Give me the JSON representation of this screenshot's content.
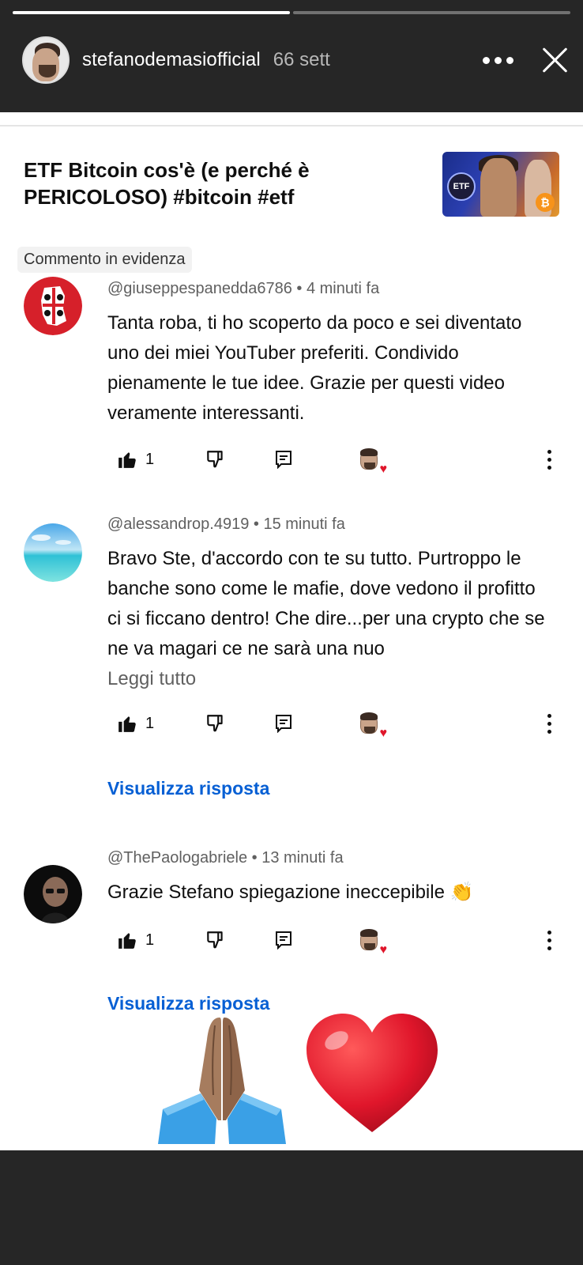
{
  "story": {
    "username": "stefanodemasiofficial",
    "time": "66 sett",
    "progress": [
      1.0,
      0.0
    ]
  },
  "video": {
    "title": "ETF Bitcoin cos'è (e perché è PERICOLOSO) #bitcoin #etf",
    "thumbnail_badge": "ETF"
  },
  "pinned_label": "Commento in evidenza",
  "comments": [
    {
      "author": "@giuseppespanedda6786",
      "time": "4 minuti fa",
      "text": "Tanta roba, ti ho scoperto da poco e sei diventato uno dei miei YouTuber preferiti. Condivido pienamente le tue idee. Grazie per questi video veramente interessanti.",
      "likes": "1"
    },
    {
      "author": "@alessandrop.4919",
      "time": "15 minuti fa",
      "text": "Bravo Ste, d'accordo con te su tutto. Purtroppo le banche sono come le mafie, dove vedono il profitto ci si ficcano dentro! Che dire...per una crypto che se ne va magari ce ne sarà una nuo",
      "read_more": "Leggi tutto",
      "likes": "1",
      "view_replies": "Visualizza risposta"
    },
    {
      "author": "@ThePaologabriele",
      "time": "13 minuti fa",
      "text": "Grazie Stefano spiegazione ineccepibile 👏",
      "likes": "1",
      "view_replies": "Visualizza risposta"
    }
  ],
  "separator": " • ",
  "icons": {
    "like": "thumbs-up-icon",
    "dislike": "thumbs-down-icon",
    "reply": "comment-icon",
    "creator_heart": "creator-heart-icon",
    "more": "vertical-dots-icon"
  },
  "stickers": [
    "folded-hands-sticker",
    "red-heart-sticker"
  ],
  "colors": {
    "link": "#065fd4",
    "heart": "#e0162b",
    "story_bg": "#262626"
  }
}
